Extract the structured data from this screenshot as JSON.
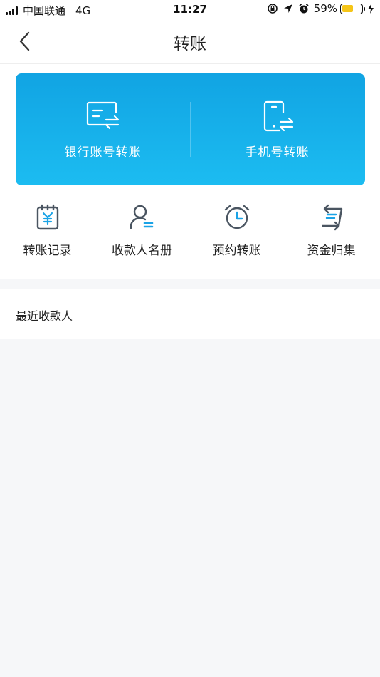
{
  "status_bar": {
    "carrier": "中国联通",
    "network": "4G",
    "time": "11:27",
    "battery_percent": "59%",
    "battery_level": 0.59
  },
  "nav": {
    "title": "转账"
  },
  "card": {
    "items": [
      {
        "label": "银行账号转账",
        "icon": "bank-card-transfer-icon"
      },
      {
        "label": "手机号转账",
        "icon": "phone-transfer-icon"
      }
    ]
  },
  "quick_actions": [
    {
      "label": "转账记录",
      "icon": "transfer-record-icon"
    },
    {
      "label": "收款人名册",
      "icon": "payee-list-icon"
    },
    {
      "label": "预约转账",
      "icon": "scheduled-transfer-icon"
    },
    {
      "label": "资金归集",
      "icon": "fund-collection-icon"
    }
  ],
  "recent": {
    "title": "最近收款人"
  },
  "colors": {
    "accent_blue": "#16b0ea",
    "icon_gray": "#4a5561",
    "icon_blue": "#1aa3e6"
  }
}
